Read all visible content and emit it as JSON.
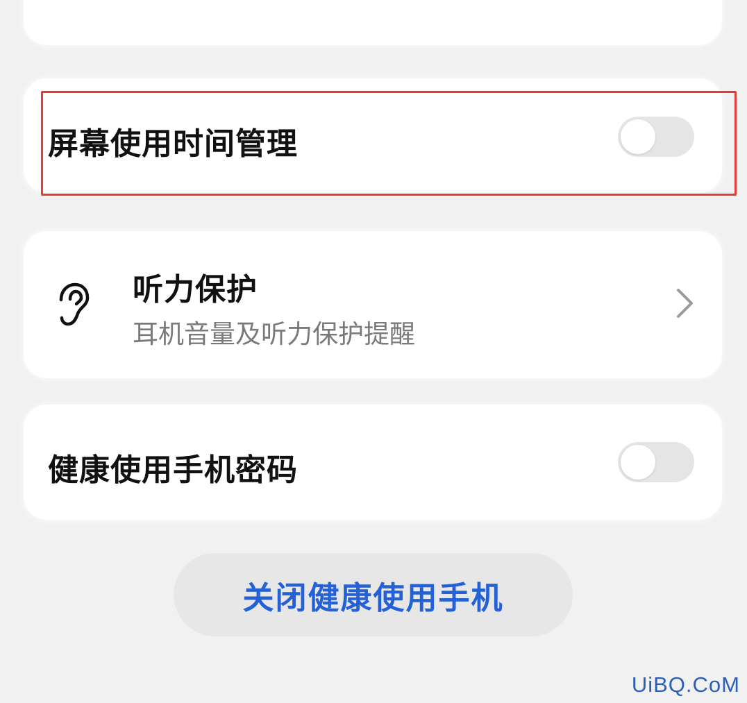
{
  "settings": {
    "screen_time": {
      "label": "屏幕使用时间管理",
      "enabled": false
    },
    "hearing_protection": {
      "title": "听力保护",
      "subtitle": "耳机音量及听力保护提醒",
      "icon": "ear-icon"
    },
    "health_password": {
      "label": "健康使用手机密码",
      "enabled": false
    }
  },
  "actions": {
    "close_healthy_usage": "关闭健康使用手机"
  },
  "watermark": "UiBQ.CoM",
  "colors": {
    "background": "#f1f1f1",
    "card": "#ffffff",
    "highlight": "#e63a35",
    "accent_blue": "#2460d6",
    "toggle_off": "#e5e5e5"
  }
}
